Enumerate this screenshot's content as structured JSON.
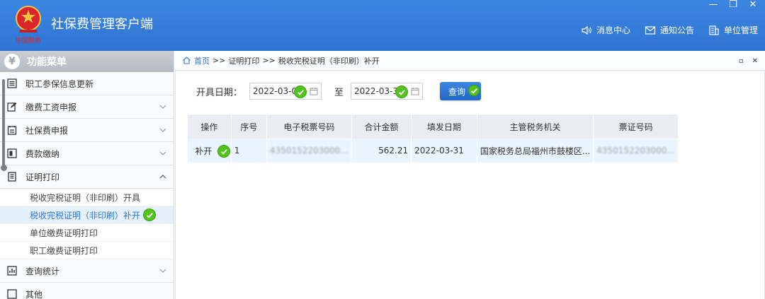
{
  "app": {
    "title": "社保费管理客户端",
    "logo_text": "中国税务"
  },
  "header_nav": [
    {
      "label": "消息中心",
      "icon": "speaker-icon"
    },
    {
      "label": "通知公告",
      "icon": "mail-icon"
    },
    {
      "label": "单位管理",
      "icon": "building-icon"
    }
  ],
  "sidebar": {
    "title": "功能菜单",
    "items": [
      {
        "label": "职工参保信息更新"
      },
      {
        "label": "缴费工资申报"
      },
      {
        "label": "社保费申报"
      },
      {
        "label": "费款缴纳"
      },
      {
        "label": "证明打印"
      },
      {
        "label": "查询统计"
      },
      {
        "label": "其他"
      }
    ],
    "sub_items": [
      {
        "label": "税收完税证明（非印刷）开具"
      },
      {
        "label": "税收完税证明（非印刷）补开"
      },
      {
        "label": "单位缴费证明打印"
      },
      {
        "label": "职工缴费证明打印"
      }
    ]
  },
  "breadcrumb": {
    "home": "首页",
    "sep": ">>",
    "level1": "证明打印",
    "level2": "税收完税证明（非印刷）补开"
  },
  "filter": {
    "label": "开具日期：",
    "start_date": "2022-03-01",
    "to_label": "至",
    "end_date": "2022-03-31",
    "query_label": "查询"
  },
  "table": {
    "headers": [
      "操作",
      "序号",
      "电子税票号码",
      "合计金额",
      "填发日期",
      "主管税务机关",
      "票证号码"
    ],
    "rows": [
      {
        "op": "补开",
        "seq": "1",
        "ticket_no": "4350152203000...",
        "amount": "562.21",
        "date": "2022-03-31",
        "authority": "国家税务总局福州市鼓楼区...",
        "voucher_no": "4350152203000..."
      }
    ]
  },
  "colors": {
    "header_blue": "#2f74d3",
    "check_green": "#52c41a"
  }
}
